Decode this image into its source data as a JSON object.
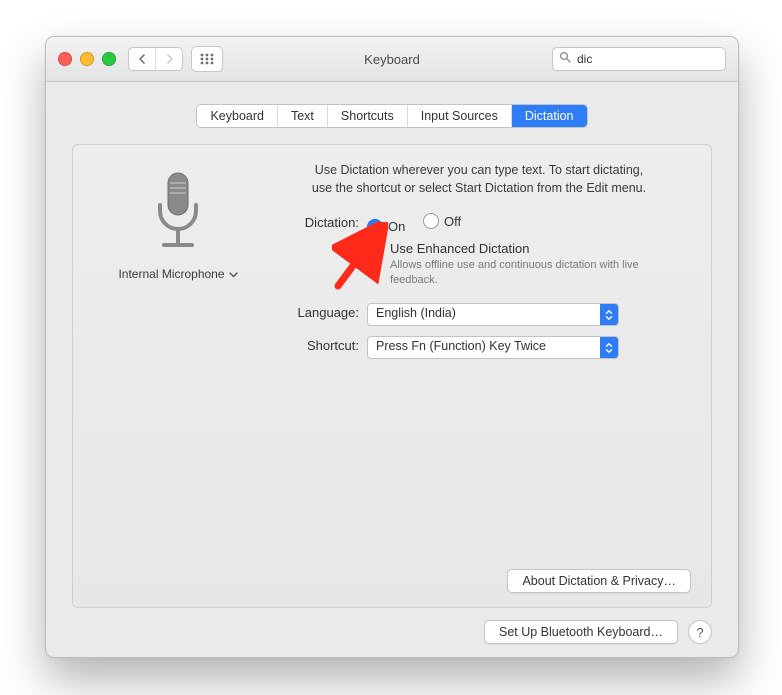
{
  "title": "Keyboard",
  "search": {
    "value": "dic"
  },
  "tabs": [
    "Keyboard",
    "Text",
    "Shortcuts",
    "Input Sources",
    "Dictation"
  ],
  "activeTab": 4,
  "mic": {
    "label": "Internal Microphone"
  },
  "intro_line1": "Use Dictation wherever you can type text. To start dictating,",
  "intro_line2": "use the shortcut or select Start Dictation from the Edit menu.",
  "labels": {
    "dictation": "Dictation:",
    "on": "On",
    "off": "Off",
    "enhanced": "Use Enhanced Dictation",
    "enhanced_sub": "Allows offline use and continuous dictation with live feedback.",
    "language": "Language:",
    "shortcut": "Shortcut:"
  },
  "language_value": "English (India)",
  "shortcut_value": "Press Fn (Function) Key Twice",
  "buttons": {
    "about": "About Dictation & Privacy…",
    "bluetooth": "Set Up Bluetooth Keyboard…"
  }
}
